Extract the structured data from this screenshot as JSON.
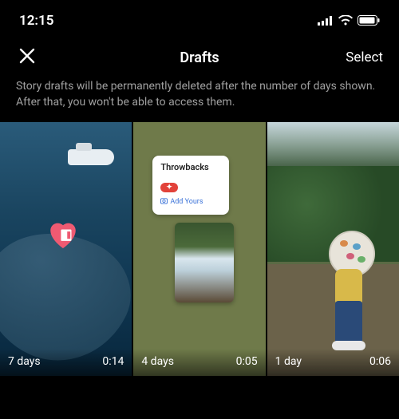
{
  "status": {
    "time": "12:15"
  },
  "nav": {
    "title": "Drafts",
    "select_label": "Select"
  },
  "info_text": "Story drafts will be permanently deleted after the number of days shown. After that, you won't be able to access them.",
  "drafts": [
    {
      "expires_label": "7 days",
      "duration": "0:14",
      "sticker_label": ""
    },
    {
      "expires_label": "4 days",
      "duration": "0:05",
      "sticker_label": "Throwbacks",
      "sticker_cta": "Add Yours"
    },
    {
      "expires_label": "1 day",
      "duration": "0:06"
    }
  ]
}
